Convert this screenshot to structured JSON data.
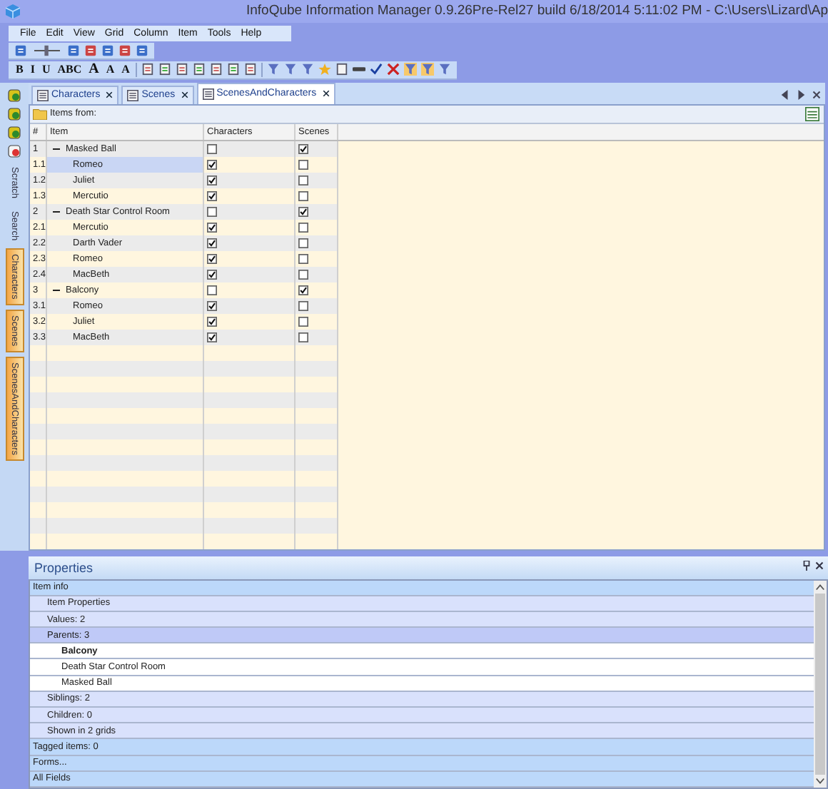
{
  "window": {
    "title": "InfoQube Information Manager 0.9.26Pre-Rel27  build 6/18/2014 5:11:02 PM - C:\\Users\\Lizard\\Ap"
  },
  "menu": [
    "File",
    "Edit",
    "View",
    "Grid",
    "Column",
    "Item",
    "Tools",
    "Help"
  ],
  "format_buttons": [
    "B",
    "I",
    "U",
    "ABC",
    "A",
    "A",
    "A"
  ],
  "tabs": [
    {
      "label": "Characters",
      "selected": false
    },
    {
      "label": "Scenes",
      "selected": false
    },
    {
      "label": "ScenesAndCharacters",
      "selected": true
    }
  ],
  "side_tabs": [
    {
      "label": "Scratch",
      "active": false
    },
    {
      "label": "Search",
      "active": false
    },
    {
      "label": "Characters",
      "active": true
    },
    {
      "label": "Scenes",
      "active": true
    },
    {
      "label": "ScenesAndCharacters",
      "active": true
    }
  ],
  "grid": {
    "source_label": "Items from:",
    "columns": [
      "#",
      "Item",
      "Characters",
      "Scenes"
    ],
    "rows": [
      {
        "num": "1",
        "item": "Masked Ball",
        "expanded": true,
        "characters": false,
        "scenes": true,
        "selected": false,
        "children": [
          {
            "num": "1.1",
            "item": "Romeo",
            "characters": true,
            "scenes": false,
            "selected": true
          },
          {
            "num": "1.2",
            "item": "Juliet",
            "characters": true,
            "scenes": false,
            "selected": false
          },
          {
            "num": "1.3",
            "item": "Mercutio",
            "characters": true,
            "scenes": false,
            "selected": false
          }
        ]
      },
      {
        "num": "2",
        "item": "Death Star Control Room",
        "expanded": true,
        "characters": false,
        "scenes": true,
        "selected": false,
        "children": [
          {
            "num": "2.1",
            "item": "Mercutio",
            "characters": true,
            "scenes": false,
            "selected": false
          },
          {
            "num": "2.2",
            "item": "Darth Vader",
            "characters": true,
            "scenes": false,
            "selected": false
          },
          {
            "num": "2.3",
            "item": "Romeo",
            "characters": true,
            "scenes": false,
            "selected": false
          },
          {
            "num": "2.4",
            "item": "MacBeth",
            "characters": true,
            "scenes": false,
            "selected": false
          }
        ]
      },
      {
        "num": "3",
        "item": "Balcony",
        "expanded": true,
        "characters": false,
        "scenes": true,
        "selected": false,
        "children": [
          {
            "num": "3.1",
            "item": "Romeo",
            "characters": true,
            "scenes": false,
            "selected": false
          },
          {
            "num": "3.2",
            "item": "Juliet",
            "characters": true,
            "scenes": false,
            "selected": false
          },
          {
            "num": "3.3",
            "item": "MacBeth",
            "characters": true,
            "scenes": false,
            "selected": false
          }
        ]
      }
    ]
  },
  "properties": {
    "title": "Properties",
    "rows": [
      {
        "label": "Item info",
        "kind": "section",
        "children": [
          {
            "label": "Item Properties",
            "kind": "field"
          },
          {
            "label": "Values: 2",
            "kind": "field"
          },
          {
            "label": "Parents: 3",
            "kind": "field",
            "selected": true,
            "children": [
              {
                "label": "Balcony",
                "kind": "value",
                "current": true
              },
              {
                "label": "Death Star Control Room",
                "kind": "value",
                "current": false
              },
              {
                "label": "Masked Ball",
                "kind": "value",
                "current": false
              }
            ]
          },
          {
            "label": "Siblings: 2",
            "kind": "field",
            "selected": false
          },
          {
            "label": "Children: 0",
            "kind": "field",
            "selected": false
          },
          {
            "label": "Shown in 2 grids",
            "kind": "field",
            "selected": false
          }
        ]
      },
      {
        "label": "Tagged items: 0",
        "kind": "section"
      },
      {
        "label": "Forms...",
        "kind": "section"
      },
      {
        "label": "All Fields",
        "kind": "section"
      }
    ]
  }
}
